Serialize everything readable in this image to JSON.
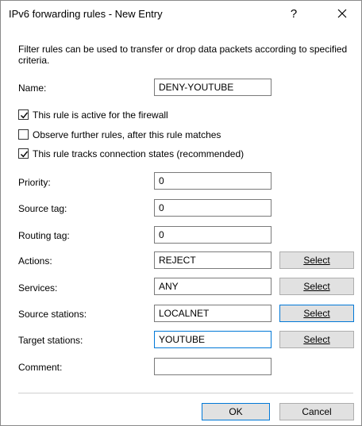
{
  "window": {
    "title": "IPv6 forwarding rules - New Entry",
    "help_glyph": "?",
    "close_icon": "close-icon"
  },
  "description": "Filter rules can be used to transfer or drop data packets according to specified criteria.",
  "name": {
    "label": "Name:",
    "value": "DENY-YOUTUBE"
  },
  "checkboxes": [
    {
      "label": "This rule is active for the firewall",
      "checked": true
    },
    {
      "label": "Observe further rules, after this rule matches",
      "checked": false
    },
    {
      "label": "This rule tracks connection states (recommended)",
      "checked": true
    }
  ],
  "priority": {
    "label": "Priority:",
    "value": "0"
  },
  "source_tag": {
    "label": "Source tag:",
    "value": "0"
  },
  "routing_tag": {
    "label": "Routing tag:",
    "value": "0"
  },
  "actions": {
    "label": "Actions:",
    "value": "REJECT",
    "button": "Select"
  },
  "services": {
    "label": "Services:",
    "value": "ANY",
    "button": "Select"
  },
  "source_stations": {
    "label": "Source stations:",
    "value": "LOCALNET",
    "button": "Select"
  },
  "target_stations": {
    "label": "Target stations:",
    "value": "YOUTUBE",
    "button": "Select"
  },
  "comment": {
    "label": "Comment:",
    "value": ""
  },
  "footer": {
    "ok": "OK",
    "cancel": "Cancel"
  },
  "colors": {
    "focus_border": "#0078d7",
    "button_face": "#e1e1e1"
  }
}
